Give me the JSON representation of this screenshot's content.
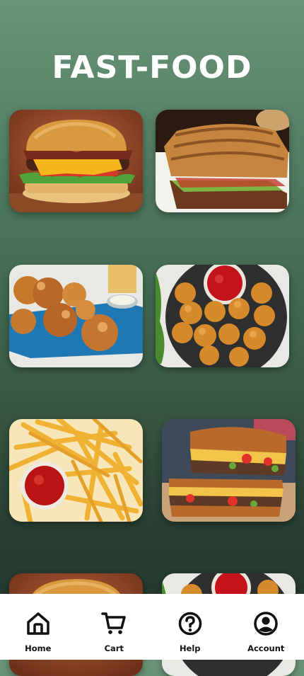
{
  "page": {
    "title": "FAST-FOOD"
  },
  "menu": {
    "items": [
      {
        "icon": "burger-image"
      },
      {
        "icon": "grilled-toast-image"
      },
      {
        "icon": "fried-chicken-image"
      },
      {
        "icon": "chicken-nuggets-image"
      },
      {
        "icon": "french-fries-image"
      },
      {
        "icon": "patty-melt-image"
      },
      {
        "icon": "burger-image"
      },
      {
        "icon": "chicken-nuggets-image"
      }
    ]
  },
  "bottom_nav": {
    "items": [
      {
        "label": "Home",
        "icon": "home-icon"
      },
      {
        "label": "Cart",
        "icon": "cart-icon"
      },
      {
        "label": "Help",
        "icon": "help-icon"
      },
      {
        "label": "Account",
        "icon": "account-icon"
      }
    ]
  },
  "colors": {
    "background_top": "#6a9478",
    "background_bottom": "#22342a",
    "title": "#ffffff",
    "nav_background": "#ffffff",
    "nav_text": "#111111"
  }
}
